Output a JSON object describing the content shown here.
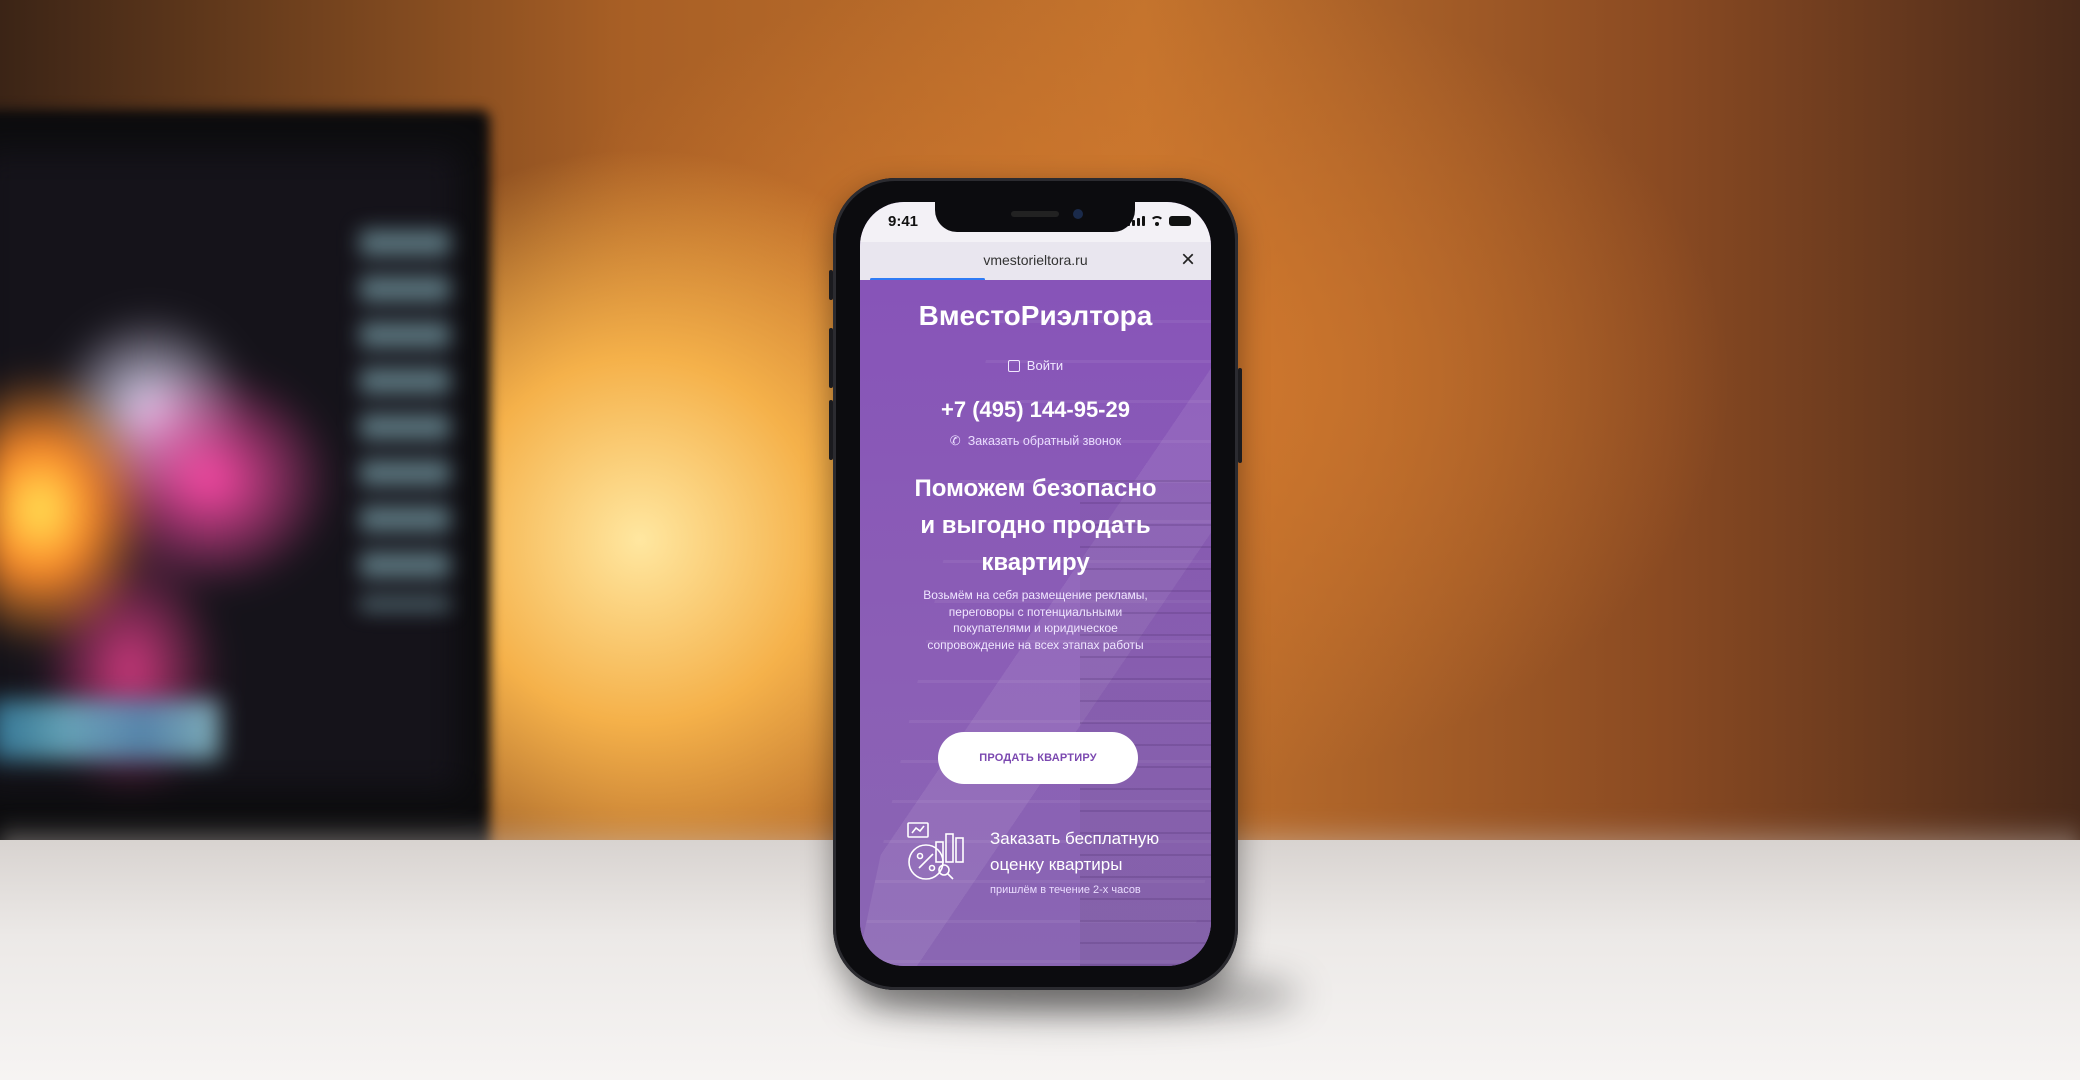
{
  "status_bar": {
    "time": "9:41"
  },
  "browser": {
    "url": "vmestorieltora.ru",
    "close_symbol": "×"
  },
  "site": {
    "brand": "ВместоРиэлтора",
    "login_label": "Войти",
    "phone": "+7 (495) 144-95-29",
    "callback_label": "Заказать обратный звонок",
    "headline_lines": [
      "Поможем безопасно",
      "и выгодно продать",
      "квартиру"
    ],
    "description_lines": [
      "Возьмём на себя размещение рекламы,",
      "переговоры с потенциальными",
      "покупателями и юридическое",
      "сопровождение на всех этапах работы"
    ],
    "cta_label": "ПРОДАТЬ КВАРТИРУ",
    "eval_title_lines": [
      "Заказать бесплатную",
      "оценку квартиры"
    ],
    "eval_subtitle": "пришлём в течение 2-х часов"
  },
  "colors": {
    "brand_purple": "#8754b8",
    "button_text": "#7b48b0",
    "progress_blue": "#2f7bf5"
  }
}
